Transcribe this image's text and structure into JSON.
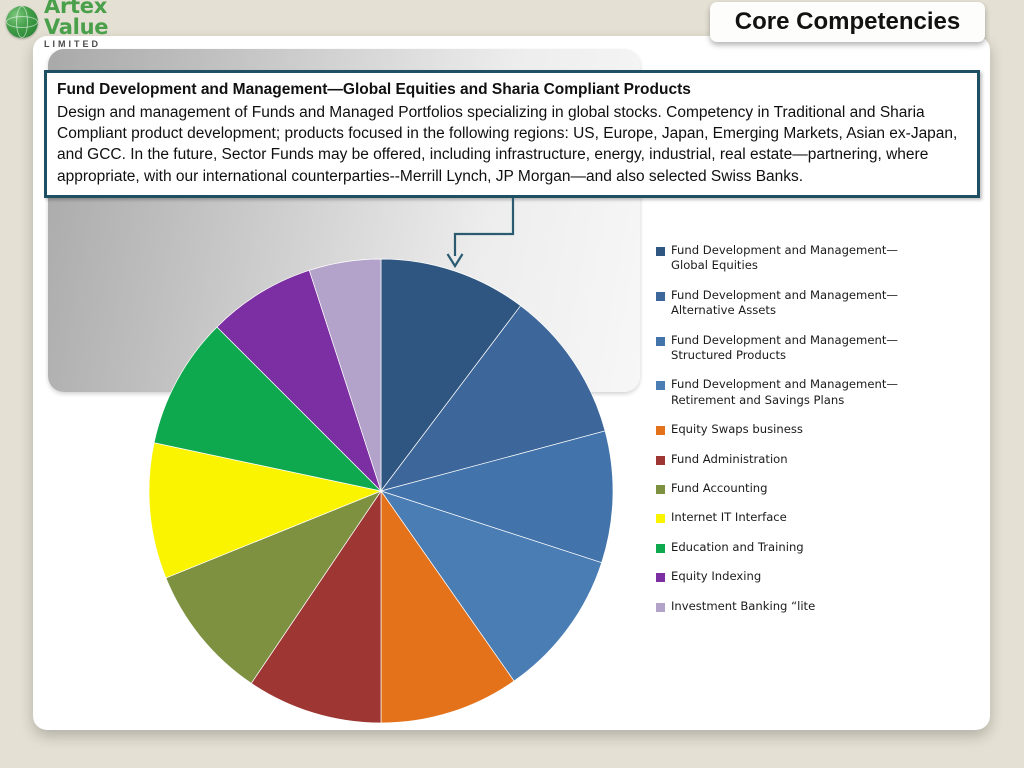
{
  "brand": {
    "name": "Artex Value",
    "subtitle": "LIMITED",
    "mark": "globe-icon"
  },
  "header": {
    "title": "Core Competencies"
  },
  "description": {
    "title": "Fund Development and Management—Global Equities and Sharia Compliant Products",
    "body": "Design and management of Funds and Managed Portfolios specializing in global stocks.  Competency in Traditional and Sharia Compliant product development; products focused in the following regions:  US, Europe, Japan, Emerging Markets, Asian ex-Japan, and GCC.  In the future, Sector Funds may be offered, including infrastructure, energy, industrial, real estate—partnering, where appropriate, with our international counterparties--Merrill Lynch, JP Morgan—and also selected Swiss Banks.",
    "border_color": "#1f4f62"
  },
  "connector": {
    "name": "elbow-arrow-connector",
    "color": "#2a5b70"
  },
  "chart_data": {
    "type": "pie",
    "title": "Core Competencies",
    "legend_position": "right",
    "start_angle_deg": 0,
    "direction": "clockwise",
    "center": [
      378,
      488
    ],
    "radius": 232,
    "categories": [
      "Fund Development and Management—Global Equities",
      "Fund Development and Management—Alternative Assets",
      "Fund Development and Management—Structured Products",
      "Fund Development and Management—Retirement and Savings Plans",
      "Equity Swaps business",
      "Fund Administration",
      "Fund Accounting",
      "Internet IT Interface",
      "Education and Training",
      "Equity Indexing",
      "Investment Banking “lite"
    ],
    "values": [
      37,
      38,
      33,
      37,
      35,
      34,
      34,
      34,
      33,
      27,
      18
    ],
    "percentages": [
      10.3,
      10.6,
      9.2,
      10.3,
      9.7,
      9.4,
      9.4,
      9.4,
      9.2,
      7.5,
      5.0
    ],
    "colors": [
      "#2e5681",
      "#3d669a",
      "#4274ab",
      "#4a7db4",
      "#e3721a",
      "#9e3733",
      "#7d9141",
      "#fbf400",
      "#0ea84e",
      "#7b2fa3",
      "#b3a2c9"
    ],
    "slice_angles_deg": [
      [
        0,
        37
      ],
      [
        37,
        75
      ],
      [
        75,
        108
      ],
      [
        108,
        145
      ],
      [
        145,
        180
      ],
      [
        180,
        214
      ],
      [
        214,
        248
      ],
      [
        248,
        282
      ],
      [
        282,
        315
      ],
      [
        315,
        342
      ],
      [
        342,
        360
      ]
    ]
  },
  "legend": {
    "items": [
      {
        "label": "Fund Development and Management—\nGlobal Equities",
        "color": "#2e5681"
      },
      {
        "label": "Fund Development and Management—\nAlternative Assets",
        "color": "#3d669a"
      },
      {
        "label": "Fund Development and Management—\nStructured Products",
        "color": "#4274ab"
      },
      {
        "label": "Fund Development and Management—\nRetirement and Savings Plans",
        "color": "#4a7db4"
      },
      {
        "label": "Equity Swaps business",
        "color": "#e3721a"
      },
      {
        "label": "Fund Administration",
        "color": "#9e3733"
      },
      {
        "label": "Fund Accounting",
        "color": "#7d9141"
      },
      {
        "label": "Internet IT Interface",
        "color": "#fbf400"
      },
      {
        "label": "Education and Training",
        "color": "#0ea84e"
      },
      {
        "label": "Equity Indexing",
        "color": "#7b2fa3"
      },
      {
        "label": "Investment Banking “lite",
        "color": "#b3a2c9"
      }
    ]
  },
  "theme": {
    "page_background": "#e4e0d3",
    "card_background": "#ffffff",
    "accent": "#1f4f62"
  }
}
